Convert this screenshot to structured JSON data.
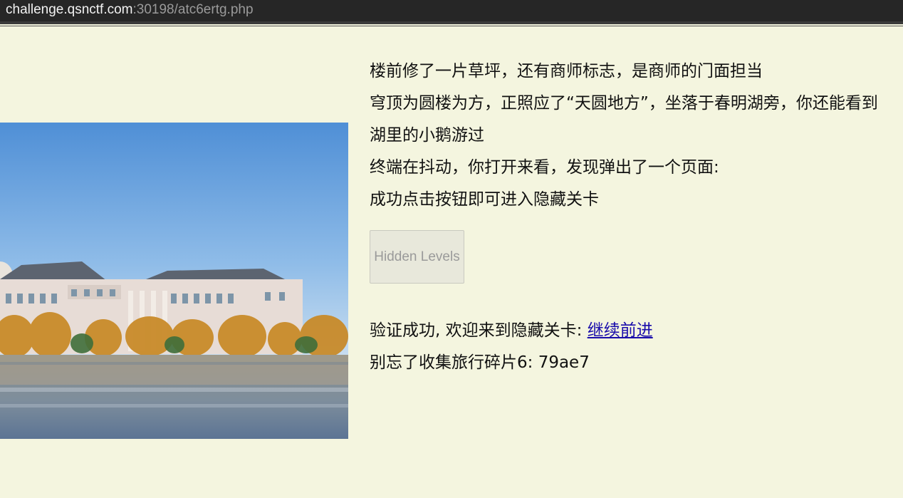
{
  "browser": {
    "url_host": "challenge.qsnctf.com",
    "url_rest": ":30198/atc6ertg.php"
  },
  "content": {
    "line1": "楼前修了一片草坪，还有商师标志，是商师的门面担当",
    "line2": "穹顶为圆楼为方，正照应了“天圆地方”，坐落于春明湖旁，你还能看到湖里的小鹅游过",
    "line3": "终端在抖动，你打开来看，发现弹出了一个页面:",
    "line4": "成功点击按钮即可进入隐藏关卡",
    "button_label": "Hidden Levels",
    "success_text": "验证成功, 欢迎来到隐藏关卡: ",
    "continue_link": "继续前进",
    "fragment_text": "别忘了收集旅行碎片6: 79ae7"
  },
  "colors": {
    "page_bg": "#f4f5df",
    "link": "#1a0dab"
  }
}
